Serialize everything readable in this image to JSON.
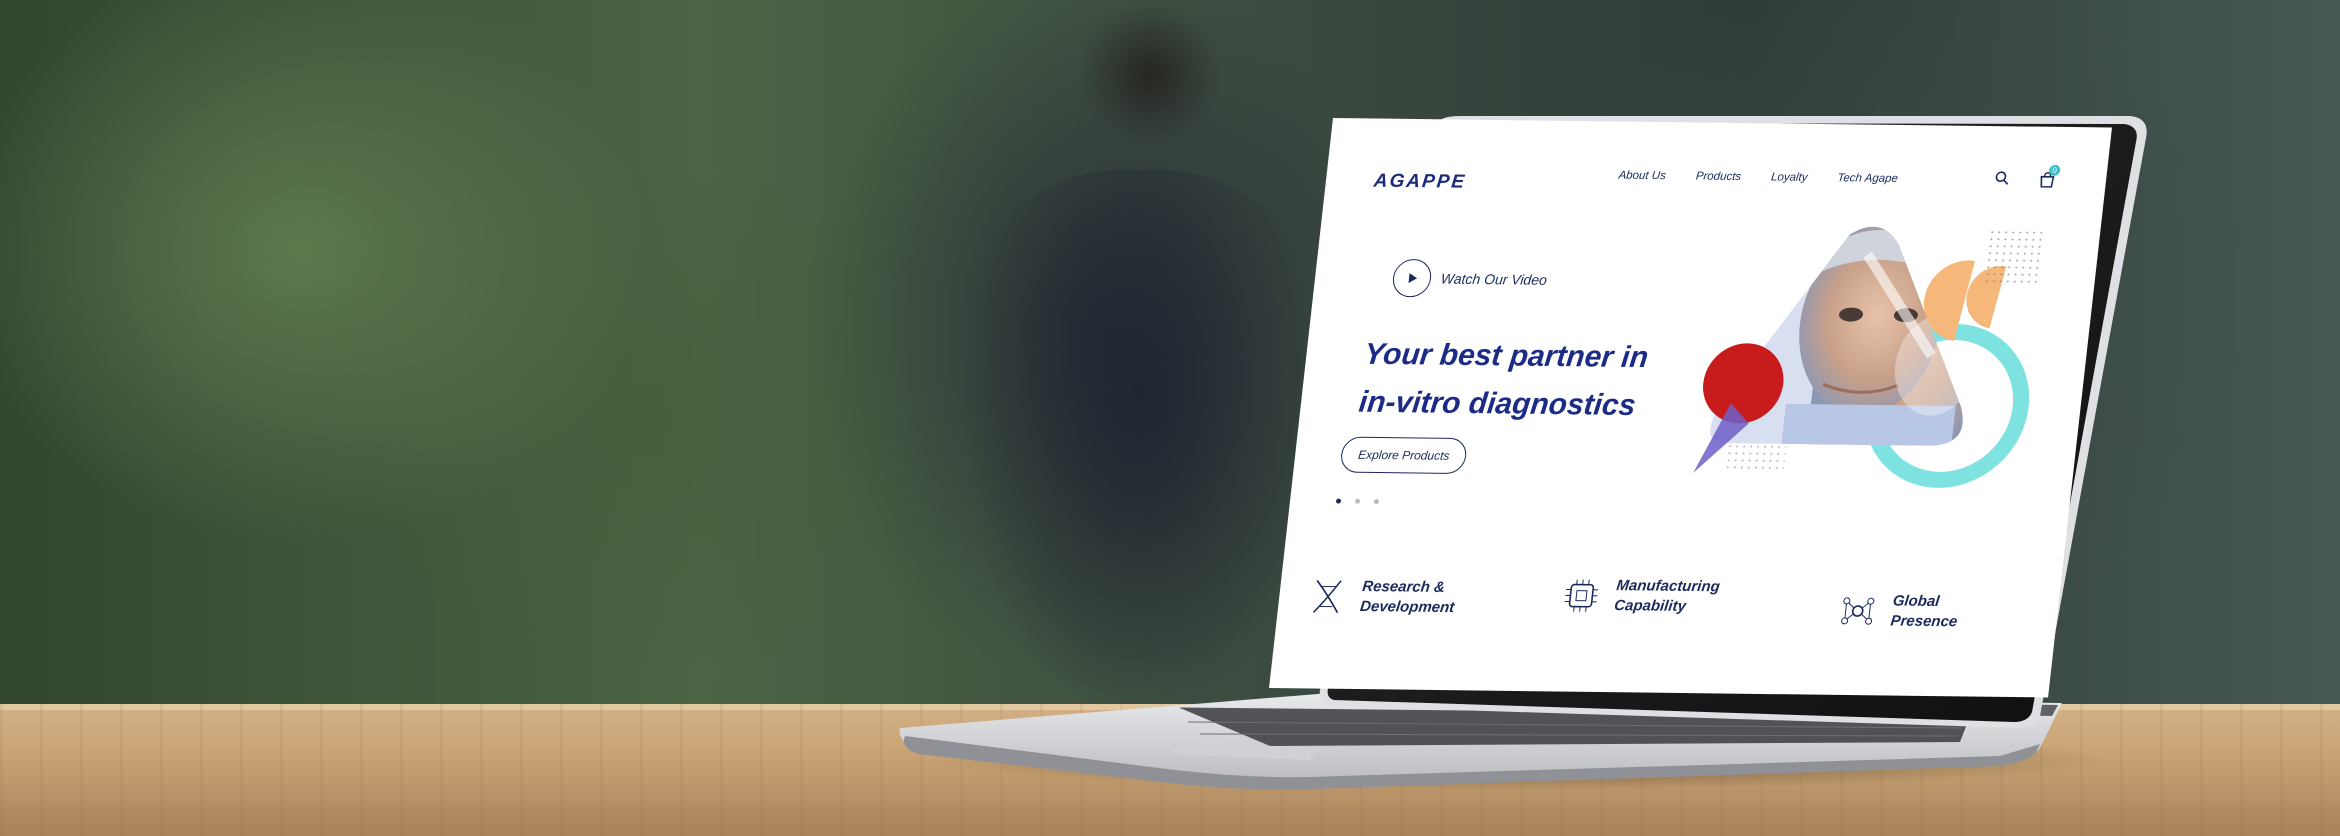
{
  "site": {
    "logo": "AGAPPE",
    "nav": [
      "About Us",
      "Products",
      "Loyalty",
      "Tech Agape"
    ],
    "cart_count": "0",
    "watch_label": "Watch Our Video",
    "headline_line1": "Your best partner in",
    "headline_line2": "in-vitro diagnostics",
    "cta_label": "Explore Products",
    "features": [
      {
        "line1": "Research &",
        "line2": "Development",
        "icon": "dna-icon"
      },
      {
        "line1": "Manufacturing",
        "line2": "Capability",
        "icon": "chip-icon"
      },
      {
        "line1": "Global",
        "line2": "Presence",
        "icon": "network-icon"
      }
    ],
    "slides_active": 1,
    "colors": {
      "brand": "#1c2c86",
      "accent": "#3ec0c8",
      "peach": "#f6b77b",
      "red": "#c81b1b"
    }
  }
}
